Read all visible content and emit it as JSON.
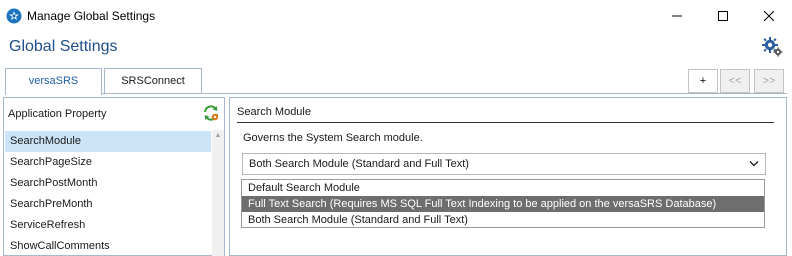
{
  "window": {
    "title": "Manage Global Settings",
    "controls": [
      "minimize",
      "maximize",
      "close"
    ]
  },
  "page": {
    "title": "Global Settings"
  },
  "tabs": [
    {
      "label": "versaSRS",
      "active": true
    },
    {
      "label": "SRSConnect",
      "active": false
    }
  ],
  "nav_buttons": {
    "add": "+",
    "prev": "<<",
    "next": ">>"
  },
  "left_panel": {
    "header": "Application Property",
    "items": [
      {
        "label": "SearchModule",
        "selected": true
      },
      {
        "label": "SearchPageSize",
        "selected": false
      },
      {
        "label": "SearchPostMonth",
        "selected": false
      },
      {
        "label": "SearchPreMonth",
        "selected": false
      },
      {
        "label": "ServiceRefresh",
        "selected": false
      },
      {
        "label": "ShowCallComments",
        "selected": false
      }
    ]
  },
  "right_panel": {
    "title": "Search Module",
    "description": "Governs the System Search module.",
    "select": {
      "value": "Both Search Module (Standard and Full Text)",
      "options": [
        "Default Search Module",
        "Full Text Search (Requires MS SQL Full Text Indexing to be applied on the versaSRS Database)",
        "Both Search Module (Standard and Full Text)"
      ],
      "highlighted_option": "Full Text Search (Requires MS SQL Full Text Indexing to be applied on the versaSRS Database)"
    }
  },
  "colors": {
    "accent": "#1f4e8c",
    "tab_active_text": "#1f5fa8",
    "selection": "#cce4f7",
    "dropdown_highlight": "#6e6e6e",
    "border": "#a7b7cc"
  },
  "icons": [
    "app-icon",
    "minimize-icon",
    "maximize-icon",
    "close-icon",
    "settings-gear-icon",
    "refresh-icon",
    "chevron-down-icon",
    "scroll-up-arrow-icon"
  ]
}
